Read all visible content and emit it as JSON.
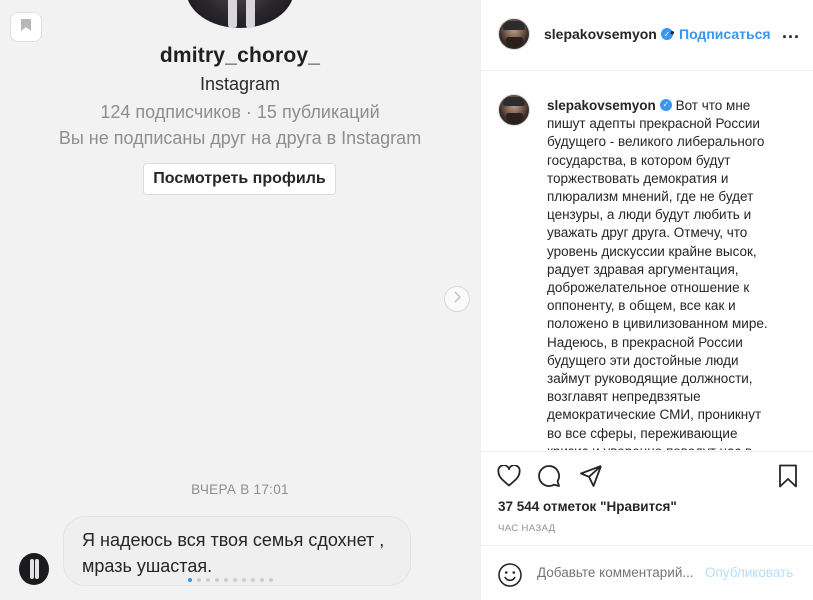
{
  "media": {
    "profile_name": "dmitry_choroy_",
    "platform": "Instagram",
    "stats": "124 подписчиков · 15 публикаций",
    "mutual": "Вы не подписаны друг на друга в Instagram",
    "view_profile_label": "Посмотреть профиль",
    "dm_time": "ВЧЕРА В 17:01",
    "dm_line1": "Я надеюсь вся твоя семья сдохнет ,",
    "dm_line2": "мразь ушастая.",
    "carousel_dots": 10,
    "carousel_active": 0
  },
  "post": {
    "username": "slepakovsemyon",
    "separator": "•",
    "follow_label": "Подписаться",
    "more_label": "...",
    "caption": "Вот что мне пишут адепты прекрасной России будущего - великого либерального государства, в котором будут торжествовать демократия и плюрализм мнений, где не будет цензуры, а люди будут любить и уважать друг друга. Отмечу, что уровень дискуссии крайне высок, радует здравая аргументация, доброжелательное отношение к оппоненту, в общем, все как и положено в цивилизованном мире. Надеюсь, в прекрасной России будущего эти достойные люди займут руководящие должности, возглавят непредвзятые демократические СМИ, проникнут во все сферы, переживающие кризис и уверенно поведут нас в",
    "likes": "37 544 отметок \"Нравится\"",
    "time_ago": "ЧАС НАЗАД",
    "comment_placeholder": "Добавьте комментарий...",
    "publish_label": "Опубликовать"
  },
  "colors": {
    "accent": "#3897f0",
    "publish_disabled": "#b2dffc",
    "muted": "#8e8e8e",
    "media_bg": "#f2f2f2"
  },
  "icons": [
    "bookmark-icon",
    "chevron-right-icon",
    "verified-icon",
    "heart-icon",
    "comment-icon",
    "share-icon",
    "save-icon",
    "emoji-icon"
  ]
}
